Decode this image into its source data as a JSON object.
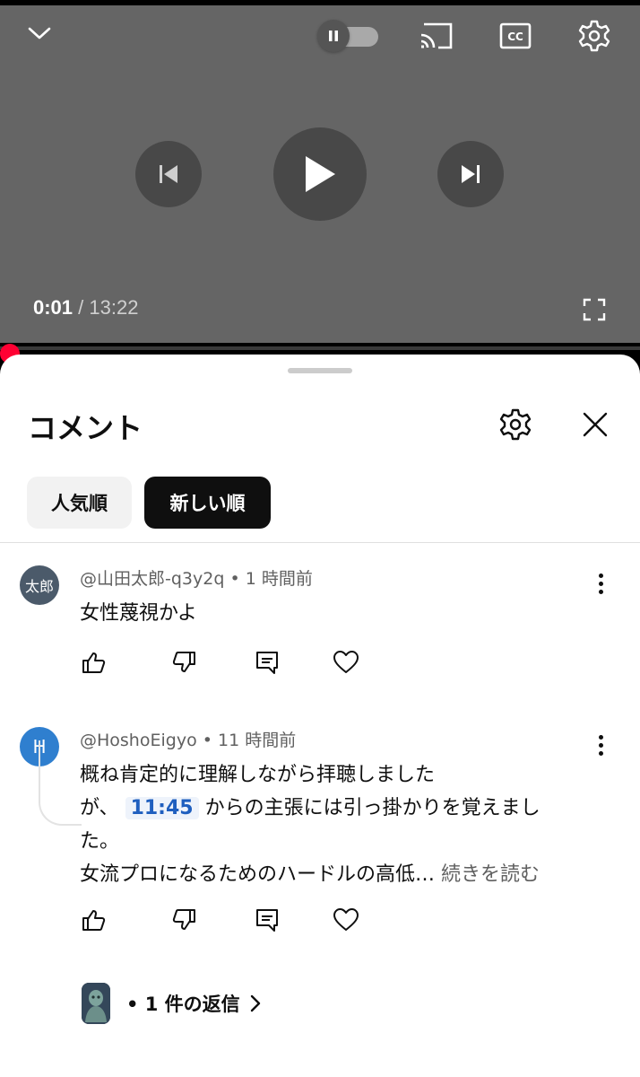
{
  "player": {
    "current_time": "0:01",
    "separator": "/",
    "duration": "13:22",
    "progress_fraction": 0.001,
    "progress_color": "#ff0033"
  },
  "icons": {
    "collapse": "chevron-down-icon",
    "autoplay": "autoplay-toggle-icon",
    "cast": "cast-icon",
    "captions": "cc-icon",
    "settings": "gear-icon",
    "previous": "skip-previous-icon",
    "play": "play-icon",
    "next": "skip-next-icon",
    "fullscreen": "fullscreen-icon",
    "close": "close-icon",
    "like": "thumb-up-icon",
    "dislike": "thumb-down-icon",
    "reply": "reply-icon",
    "heart": "heart-icon",
    "more": "more-vert-icon",
    "reply_chevron": "chevron-right-icon"
  },
  "comments_panel": {
    "title": "コメント",
    "chips": [
      {
        "label": "人気順",
        "selected": false
      },
      {
        "label": "新しい順",
        "selected": true
      }
    ]
  },
  "comments": [
    {
      "avatar_text": "太郎",
      "author": "@山田太郎-q3y2q",
      "dot": "•",
      "time": "1 時間前",
      "text": "女性蔑視かよ"
    },
    {
      "avatar_text": "H",
      "author": "@HoshoEigyo",
      "dot": "•",
      "time": "11 時間前",
      "line1": "概ね肯定的に理解しながら拝聴しました",
      "line2_pre": "が、",
      "timestamp_link": "11:45",
      "line2_post": "からの主張には引っ掛かりを覚えまし",
      "line3": "た。",
      "line4": "女流プロになるためのハードルの高低…",
      "read_more": "続きを読む",
      "replies_label": "• 1 件の返信"
    }
  ]
}
